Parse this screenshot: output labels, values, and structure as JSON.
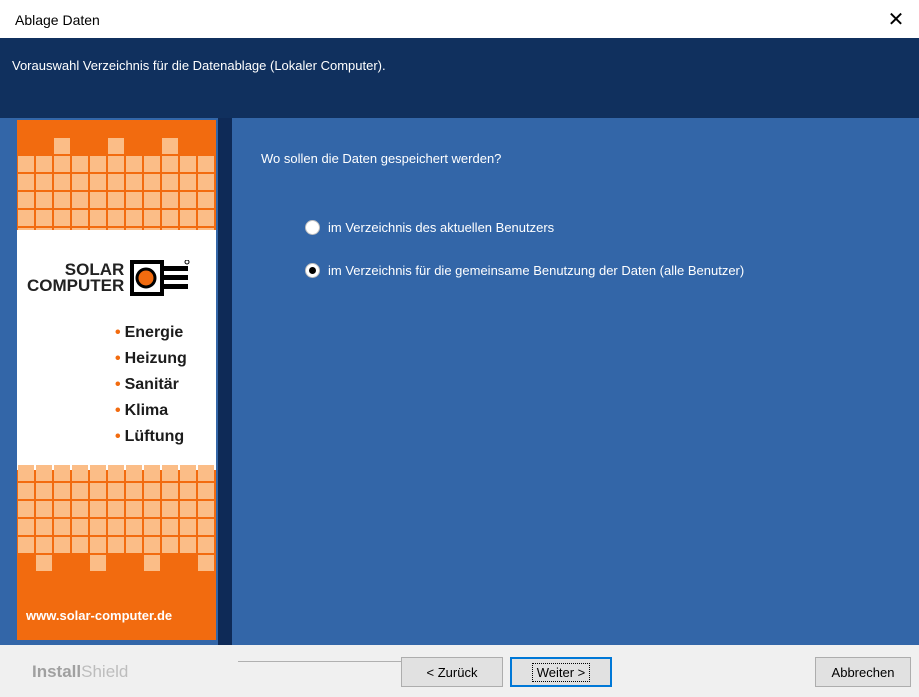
{
  "window": {
    "title": "Ablage Daten",
    "close_glyph": "✕"
  },
  "header": {
    "text": "Vorauswahl Verzeichnis für die Datenablage (Lokaler Computer)."
  },
  "banner": {
    "brand_line1": "SOLAR",
    "brand_line2": "COMPUTER",
    "bullets": [
      "Energie",
      "Heizung",
      "Sanitär",
      "Klima",
      "Lüftung"
    ],
    "url": "www.solar-computer.de",
    "colors": {
      "orange": "#f26b0f",
      "light_orange": "#fbbd87"
    }
  },
  "main": {
    "question": "Wo sollen die Daten gespeichert werden?",
    "options": [
      {
        "label": "im Verzeichnis des aktuellen Benutzers",
        "selected": false
      },
      {
        "label": "im Verzeichnis für die gemeinsame Benutzung der Daten (alle Benutzer)",
        "selected": true
      }
    ]
  },
  "footer": {
    "brand_a": "Install",
    "brand_b": "Shield",
    "back_label": "< Zurück",
    "next_label": "Weiter >",
    "cancel_label": "Abbrechen"
  }
}
